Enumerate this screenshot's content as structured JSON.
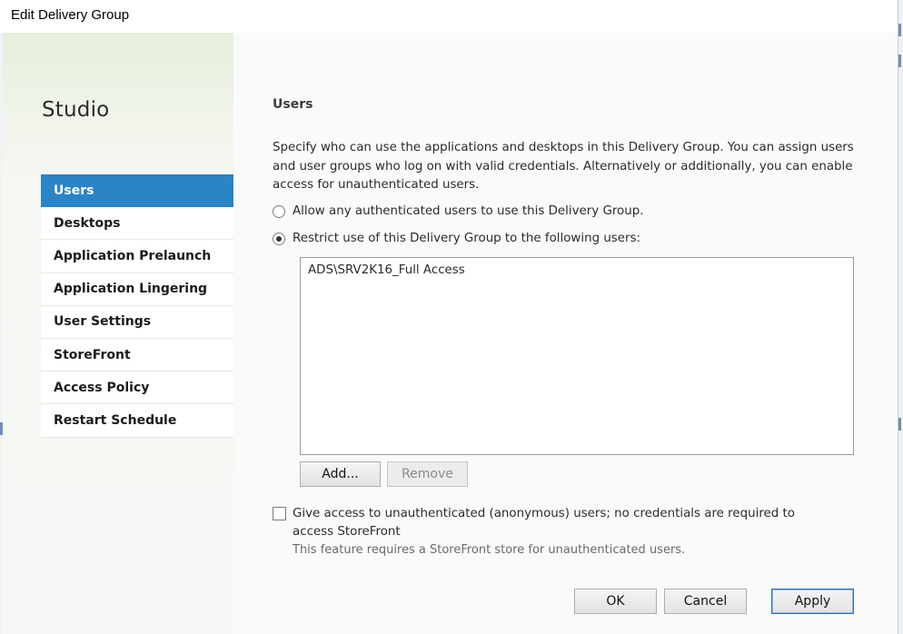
{
  "window": {
    "title": "Edit Delivery Group"
  },
  "sidebar": {
    "brand": "Studio",
    "items": [
      {
        "label": "Users",
        "active": true
      },
      {
        "label": "Desktops"
      },
      {
        "label": "Application Prelaunch"
      },
      {
        "label": "Application Lingering"
      },
      {
        "label": "User Settings"
      },
      {
        "label": "StoreFront"
      },
      {
        "label": "Access Policy"
      },
      {
        "label": "Restart Schedule"
      }
    ]
  },
  "main": {
    "heading": "Users",
    "description": "Specify who can use the applications and desktops in this Delivery Group. You can assign users and user groups who log on with valid credentials. Alternatively or additionally, you can enable access for unauthenticated users.",
    "radio_any": {
      "label": "Allow any authenticated users to use this Delivery Group.",
      "checked": false
    },
    "radio_restrict": {
      "label": "Restrict use of this Delivery Group to the following users:",
      "checked": true
    },
    "users": [
      "ADS\\SRV2K16_Full Access"
    ],
    "add_label": "Add...",
    "remove_label": "Remove",
    "anonymous_label": "Give access to unauthenticated (anonymous) users; no credentials are required to access StoreFront",
    "anonymous_checked": false,
    "anonymous_note": "This feature requires a StoreFront store for unauthenticated users."
  },
  "footer": {
    "ok_label": "OK",
    "cancel_label": "Cancel",
    "apply_label": "Apply"
  },
  "colors": {
    "accent": "#2b84c6",
    "background_tint": "#e7efdc"
  }
}
